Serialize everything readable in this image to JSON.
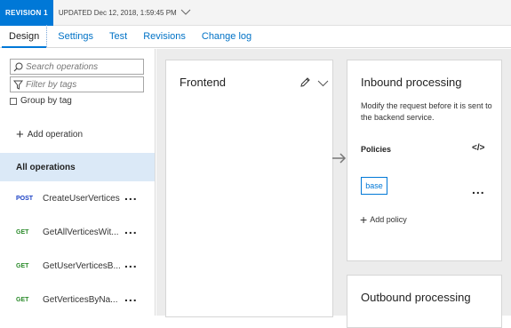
{
  "revision": {
    "badge": "REVISION 1",
    "updated": "UPDATED Dec 12, 2018, 1:59:45 PM"
  },
  "tabs": [
    {
      "label": "Design",
      "active": true
    },
    {
      "label": "Settings"
    },
    {
      "label": "Test"
    },
    {
      "label": "Revisions"
    },
    {
      "label": "Change log"
    }
  ],
  "left": {
    "search_placeholder": "Search operations",
    "filter_placeholder": "Filter by tags",
    "group_by_tag": "Group by tag",
    "add_operation": "Add operation",
    "all_operations": "All operations",
    "operations": [
      {
        "method": "POST",
        "name": "CreateUserVertices"
      },
      {
        "method": "GET",
        "name": "GetAllVerticesWit..."
      },
      {
        "method": "GET",
        "name": "GetUserVerticesB..."
      },
      {
        "method": "GET",
        "name": "GetVerticesByNa..."
      }
    ],
    "more": "..."
  },
  "frontend": {
    "title": "Frontend"
  },
  "inbound": {
    "title": "Inbound processing",
    "description": "Modify the request before it is sent to the backend service.",
    "policies": "Policies",
    "code_icon": "</>",
    "base": "base",
    "more": "...",
    "add_policy": "Add policy"
  },
  "outbound": {
    "title": "Outbound processing"
  },
  "colors": {
    "accent": "#0078d7",
    "selected_bg": "#dbe9f7",
    "post": "#1a40c4",
    "get": "#2a8a2a"
  }
}
